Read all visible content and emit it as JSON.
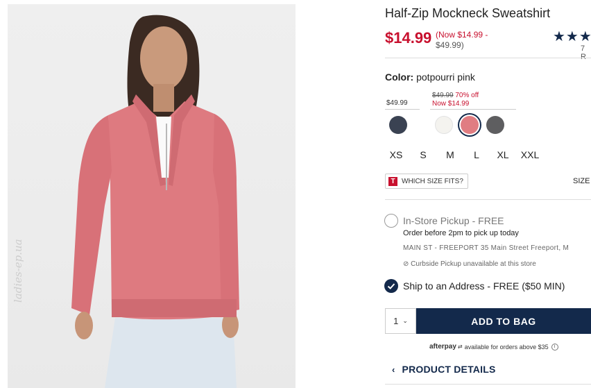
{
  "product": {
    "title": "Half-Zip Mockneck Sweatshirt",
    "price": "$14.99",
    "price_range": "(Now $14.99 -",
    "price_range_max": "$49.99)",
    "rating_stars": "★★★",
    "review_count": "7 R"
  },
  "color": {
    "label": "Color:",
    "value": "potpourri pink",
    "price_groups": [
      {
        "price": "$49.99"
      },
      {
        "original": "$49.99",
        "discount": "70% off",
        "now": "Now $14.99"
      }
    ],
    "swatches": [
      {
        "name": "navy",
        "hex": "#3a4252",
        "selected": false
      },
      {
        "name": "white",
        "hex": "#f4f3ef",
        "selected": false
      },
      {
        "name": "potpourri pink",
        "hex": "#e07d82",
        "selected": true
      },
      {
        "name": "gray",
        "hex": "#5e5e60",
        "selected": false
      }
    ]
  },
  "sizes": [
    "XS",
    "S",
    "M",
    "L",
    "XL",
    "XXL"
  ],
  "size_help": {
    "badge": "T",
    "label": "WHICH SIZE FITS?",
    "chart": "SIZE"
  },
  "fulfillment": {
    "pickup_title": "In-Store Pickup - FREE",
    "pickup_note": "Order before 2pm to pick up today",
    "store": "MAIN ST - FREEPORT 35 Main Street Freeport, M",
    "curbside": "Curbside Pickup unavailable at this store",
    "ship_label": "Ship to an Address - FREE ($50 MIN)"
  },
  "cart": {
    "quantity": "1",
    "add_label": "ADD TO BAG"
  },
  "afterpay": {
    "brand": "afterpay",
    "text": "available for orders above $35"
  },
  "product_details_label": "PRODUCT DETAILS",
  "watermark": "ladies-ep.ua",
  "colors": {
    "sale_red": "#c8102e",
    "navy": "#13294b"
  }
}
